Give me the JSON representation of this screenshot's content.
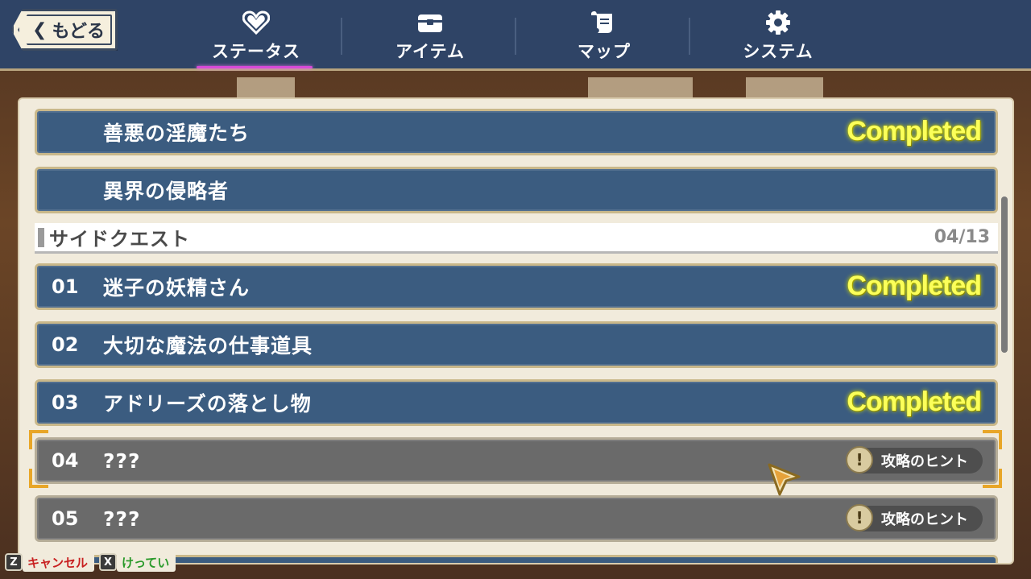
{
  "header": {
    "back_label": "もどる",
    "tabs": [
      {
        "label": "ステータス",
        "icon": "heart-icon",
        "active": true
      },
      {
        "label": "アイテム",
        "icon": "chest-icon",
        "active": false
      },
      {
        "label": "マップ",
        "icon": "scroll-map-icon",
        "active": false
      },
      {
        "label": "システム",
        "icon": "gear-icon",
        "active": false
      }
    ]
  },
  "quests_main": [
    {
      "title": "善悪の淫魔たち",
      "status": "Completed"
    },
    {
      "title": "異界の侵略者",
      "status": ""
    }
  ],
  "side_section": {
    "title": "サイドクエスト",
    "count": "04/13"
  },
  "quests_side": [
    {
      "num": "01",
      "title": "迷子の妖精さん",
      "status": "Completed"
    },
    {
      "num": "02",
      "title": "大切な魔法の仕事道具",
      "status": ""
    },
    {
      "num": "03",
      "title": "アドリーズの落とし物",
      "status": "Completed"
    },
    {
      "num": "04",
      "title": "???",
      "status": "",
      "hint": "攻略のヒント"
    },
    {
      "num": "05",
      "title": "???",
      "status": "",
      "hint": "攻略のヒント"
    }
  ],
  "footer": {
    "cancel_key": "Z",
    "cancel_label": "キャンセル",
    "confirm_key": "X",
    "confirm_label": "けってい"
  },
  "colors": {
    "header_bg": "#2f4466",
    "row_blue": "#3b5c80",
    "row_locked": "#6a6a6a",
    "completed_text": "#fbff5a",
    "active_tab_underline": "#d84ad8",
    "selection_corner": "#e8a628"
  }
}
